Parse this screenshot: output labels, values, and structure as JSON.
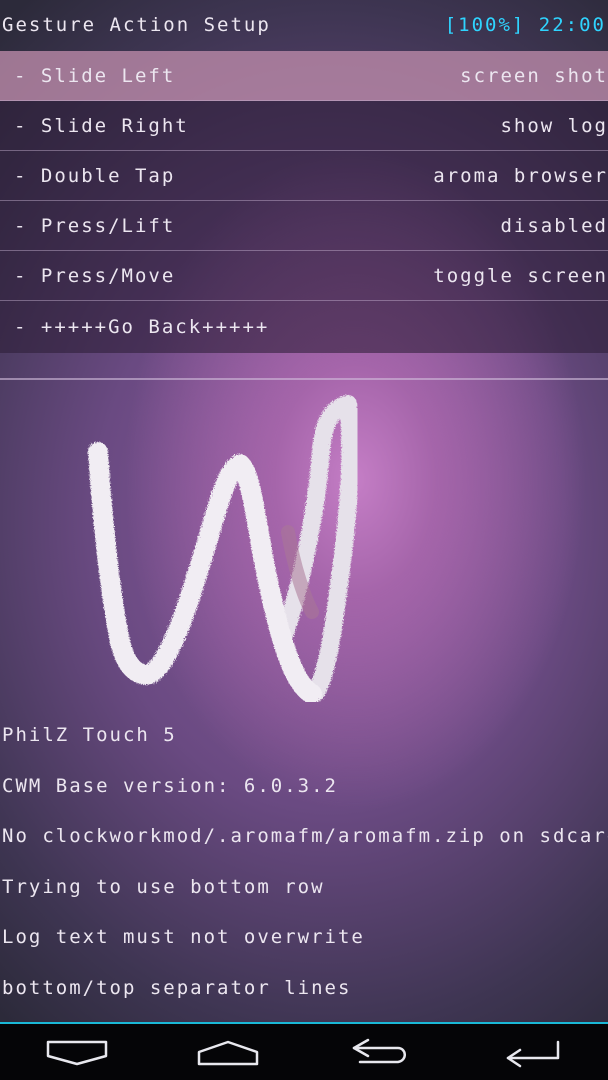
{
  "header": {
    "title": "Gesture Action Setup",
    "battery": "[100%]",
    "time": "22:00"
  },
  "menu": {
    "items": [
      {
        "label": "- Slide Left",
        "value": "screen shot",
        "selected": true
      },
      {
        "label": "- Slide Right",
        "value": "show log",
        "selected": false
      },
      {
        "label": "- Double Tap",
        "value": "aroma browser",
        "selected": false
      },
      {
        "label": "- Press/Lift",
        "value": "disabled",
        "selected": false
      },
      {
        "label": "- Press/Move",
        "value": "toggle screen",
        "selected": false
      },
      {
        "label": "- +++++Go Back+++++",
        "value": "",
        "selected": false
      }
    ]
  },
  "log": {
    "lines": [
      "PhilZ Touch 5",
      "CWM Base version: 6.0.3.2",
      "No clockworkmod/.aromafm/aromafm.zip on sdcards",
      "Trying to use bottom row",
      "Log text must not overwrite",
      "bottom/top separator lines"
    ]
  },
  "navbar": {
    "buttons": [
      "menu-icon",
      "home-icon",
      "back-icon",
      "select-icon"
    ]
  },
  "colors": {
    "status": "#2fd4ff",
    "selected_row": "#be8caa",
    "navbar_accent": "#1ab8d6",
    "text": "#ece6f0"
  }
}
